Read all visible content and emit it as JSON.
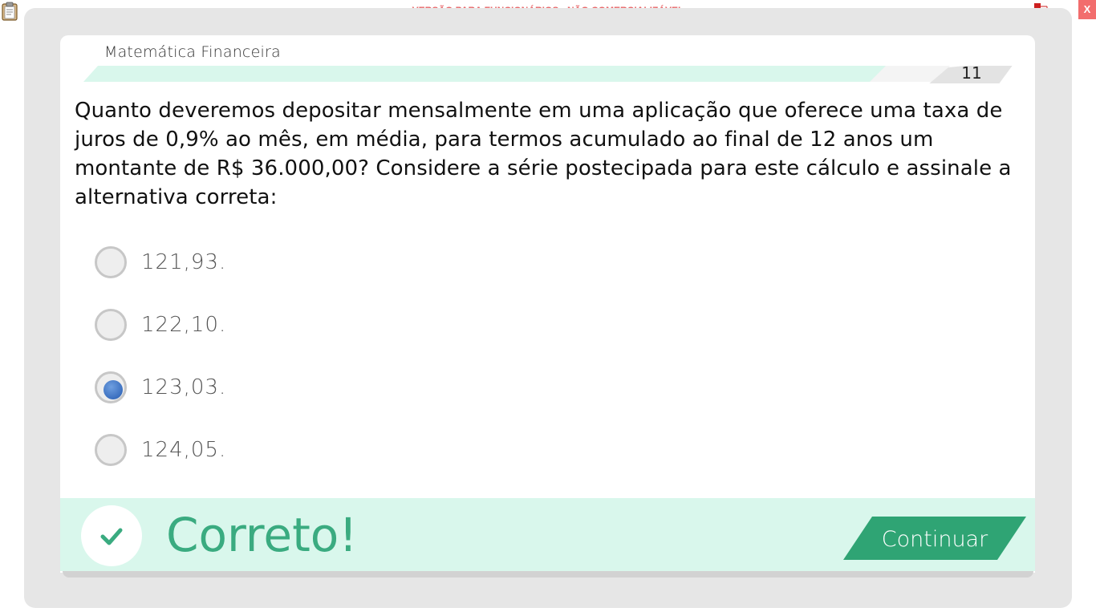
{
  "window": {
    "watermark": "VERSÃO PARA FUNCIONÁRIOS - NÃO COMERCIALIZÁVEL",
    "close_label": "X",
    "icons": [
      "clipboard-icon",
      "network-icon"
    ]
  },
  "header": {
    "subject": "Matemática Financeira",
    "question_number": "11"
  },
  "question": {
    "text": "Quanto deveremos depositar mensalmente em uma aplicação que oferece uma taxa de juros de 0,9% ao mês, em média, para termos acumulado ao final de 12 anos um montante de R$ 36.000,00? Considere a série postecipada para este cálculo e assinale a alternativa correta:"
  },
  "options": [
    {
      "label": "121,93.",
      "selected": false
    },
    {
      "label": "122,10.",
      "selected": false
    },
    {
      "label": "123,03.",
      "selected": true
    },
    {
      "label": "124,05.",
      "selected": false
    }
  ],
  "feedback": {
    "message": "Correto!",
    "continue_label": "Continuar",
    "icon": "checkmark-icon"
  },
  "colors": {
    "accent_green": "#3aab80",
    "feedback_bg": "#d9f7ec",
    "watermark_red": "#e8696b",
    "radio_selected_blue": "#3b6fbf"
  }
}
